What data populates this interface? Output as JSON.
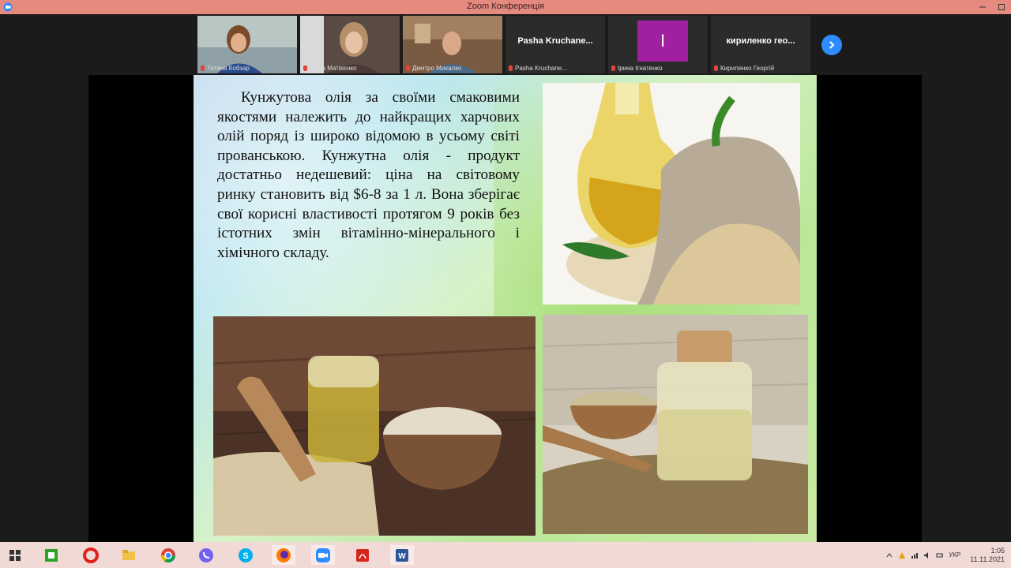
{
  "window": {
    "title": "Zoom Конференція"
  },
  "participants": [
    {
      "name": "Тетяна Кобзар",
      "type": "video"
    },
    {
      "name": "Ірина Матвієнко",
      "type": "video"
    },
    {
      "name": "Дмитро Михалко",
      "type": "video"
    },
    {
      "name": "Pasha Kruchane...",
      "label": "Pasha Kruchane...",
      "type": "name"
    },
    {
      "name": "Ірина Ігнатенко",
      "label": "I",
      "type": "avatar"
    },
    {
      "name": "Кириленко Георгій",
      "label": "кириленко гео...",
      "type": "name"
    }
  ],
  "slide": {
    "paragraph": "Кунжутова олія за своїми смаковими якостями належить до найкращих харчових олій поряд із широко відомою в усьому світі прованською. Кунжутна олія - продукт достатньо недешевий: ціна на світовому ринку становить від $6-8 за 1 л. Вона зберігає свої корисні властивості протягом 9 років без істотних змін вітамінно-мінерального і хімічного складу.",
    "images": [
      {
        "icon": "sesame-oil-bottle-and-sack-photo"
      },
      {
        "icon": "sesame-oil-jar-and-bowl-photo"
      },
      {
        "icon": "sesame-oil-cork-jar-photo"
      }
    ]
  },
  "taskbar": {
    "apps": [
      "windows-start-icon",
      "file-manager-icon",
      "opera-icon",
      "explorer-icon",
      "chrome-icon",
      "viber-icon",
      "skype-icon",
      "firefox-icon",
      "zoom-icon",
      "acrobat-icon",
      "word-icon"
    ],
    "clock_time": "1:05",
    "clock_date": "11.11.2021",
    "lang": "УКР"
  },
  "colors": {
    "titlebar": "#e58a7f",
    "taskbar": "#f1d9d6",
    "zoom_blue": "#2d8cff",
    "avatar": "#a020a0"
  }
}
